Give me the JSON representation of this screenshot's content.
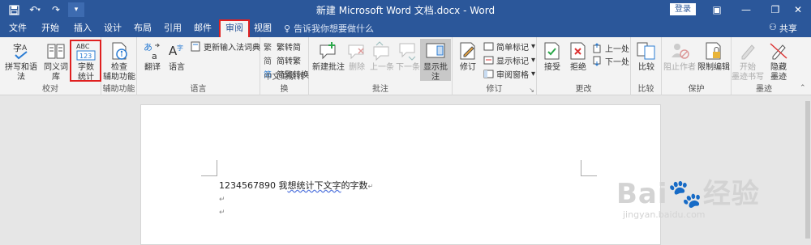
{
  "titlebar": {
    "title": "新建 Microsoft Word 文档.docx - Word",
    "login": "登录"
  },
  "tabs": [
    "文件",
    "开始",
    "插入",
    "设计",
    "布局",
    "引用",
    "邮件",
    "审阅",
    "视图"
  ],
  "active_tab": "审阅",
  "tellme": "告诉我你想要做什么",
  "share": "共享",
  "ribbon": {
    "proofing": {
      "label": "校对",
      "spelling": "拼写和语法",
      "thesaurus": "同义词库",
      "wordcount_line1": "字数",
      "wordcount_line2": "统计"
    },
    "accessibility": {
      "label": "辅助功能",
      "check_line1": "检查",
      "check_line2": "辅助功能"
    },
    "language": {
      "label": "语言",
      "translate": "翻译",
      "language": "语言",
      "update_ime": "更新输入法词典"
    },
    "chinese": {
      "label": "中文简繁转换",
      "to_simplified": "繁转简",
      "to_traditional": "简转繁",
      "convert": "简繁转换"
    },
    "comments": {
      "label": "批注",
      "new": "新建批注",
      "delete": "删除",
      "previous": "上一条",
      "next": "下一条",
      "show": "显示批注"
    },
    "tracking": {
      "label": "修订",
      "track": "修订",
      "simple_markup": "简单标记",
      "show_markup": "显示标记",
      "review_pane": "审阅窗格"
    },
    "changes": {
      "label": "更改",
      "accept": "接受",
      "reject": "拒绝",
      "previous": "上一处",
      "next": "下一处"
    },
    "compare": {
      "label": "比较",
      "compare": "比较"
    },
    "protect": {
      "label": "保护",
      "block_authors": "阻止作者",
      "restrict_editing": "限制编辑"
    },
    "ink": {
      "label": "墨迹",
      "start_inking_line1": "开始",
      "start_inking_line2": "墨迹书写",
      "hide_ink_line1": "隐藏",
      "hide_ink_line2": "墨迹"
    }
  },
  "document": {
    "line1_prefix": "1234567890 我",
    "line1_squiggle": "想统计下文字",
    "line1_suffix": "的字数",
    "para_mark": "↵"
  },
  "watermark": {
    "brand": "Bai🐾经验",
    "url": "jingyan.baidu.com"
  },
  "colors": {
    "accent": "#2b579a",
    "highlight_box": "#e02020"
  }
}
